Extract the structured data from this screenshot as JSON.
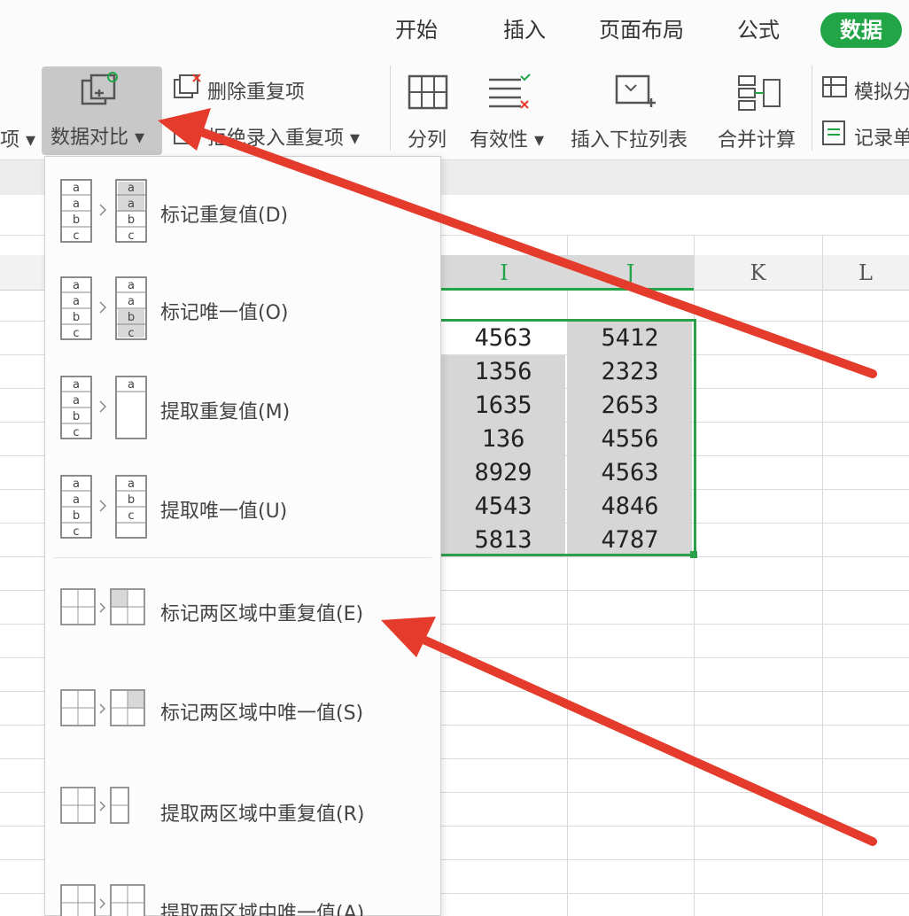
{
  "ribbon": {
    "tabs": [
      "开始",
      "插入",
      "页面布局",
      "公式",
      "数据"
    ],
    "left_partial": "项",
    "data_compare": "数据对比",
    "delete_dup": "删除重复项",
    "reject_dup": "拒绝录入重复项",
    "split": "分列",
    "validity": "有效性",
    "insert_dropdown": "插入下拉列表",
    "consolidate": "合并计算",
    "simulate": "模拟分",
    "record": "记录单"
  },
  "sheet": {
    "columns": [
      "I",
      "J",
      "K",
      "L"
    ],
    "col_i": [
      "4563",
      "1356",
      "1635",
      "136",
      "8929",
      "4543",
      "5813"
    ],
    "col_j": [
      "5412",
      "2323",
      "2653",
      "4556",
      "4563",
      "4846",
      "4787"
    ]
  },
  "menu": {
    "items": [
      "标记重复值(D)",
      "标记唯一值(O)",
      "提取重复值(M)",
      "提取唯一值(U)",
      "标记两区域中重复值(E)",
      "标记两区域中唯一值(S)",
      "提取两区域中重复值(R)",
      "提取两区域中唯一值(A)"
    ],
    "icon_letters": [
      "a",
      "a",
      "b",
      "c"
    ]
  },
  "colors": {
    "accent": "#22a547",
    "arrow": "#e53b2c"
  }
}
